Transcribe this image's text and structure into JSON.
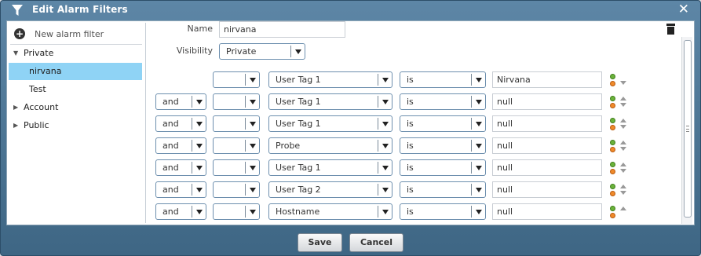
{
  "dialog": {
    "title": "Edit Alarm Filters"
  },
  "tree": {
    "new_filter": "New alarm filter",
    "nodes": [
      {
        "label": "Private",
        "expanded": true
      },
      {
        "label": "nirvana",
        "selected": true
      },
      {
        "label": "Test"
      },
      {
        "label": "Account",
        "expanded": false
      },
      {
        "label": "Public",
        "expanded": false
      }
    ]
  },
  "form": {
    "name_label": "Name",
    "name_value": "nirvana",
    "visibility_label": "Visibility",
    "visibility_value": "Private"
  },
  "rows": [
    {
      "conj": "",
      "paren": "",
      "field": "User Tag 1",
      "op": "is",
      "value": "Nirvana"
    },
    {
      "conj": "and",
      "paren": "",
      "field": "User Tag 1",
      "op": "is",
      "value": "null"
    },
    {
      "conj": "and",
      "paren": "",
      "field": "User Tag 1",
      "op": "is",
      "value": "null"
    },
    {
      "conj": "and",
      "paren": "",
      "field": "Probe",
      "op": "is",
      "value": "null"
    },
    {
      "conj": "and",
      "paren": "",
      "field": "User Tag 1",
      "op": "is",
      "value": "null"
    },
    {
      "conj": "and",
      "paren": "",
      "field": "User Tag 2",
      "op": "is",
      "value": "null"
    },
    {
      "conj": "and",
      "paren": "",
      "field": "Hostname",
      "op": "is",
      "value": "null"
    }
  ],
  "buttons": {
    "save": "Save",
    "cancel": "Cancel"
  }
}
